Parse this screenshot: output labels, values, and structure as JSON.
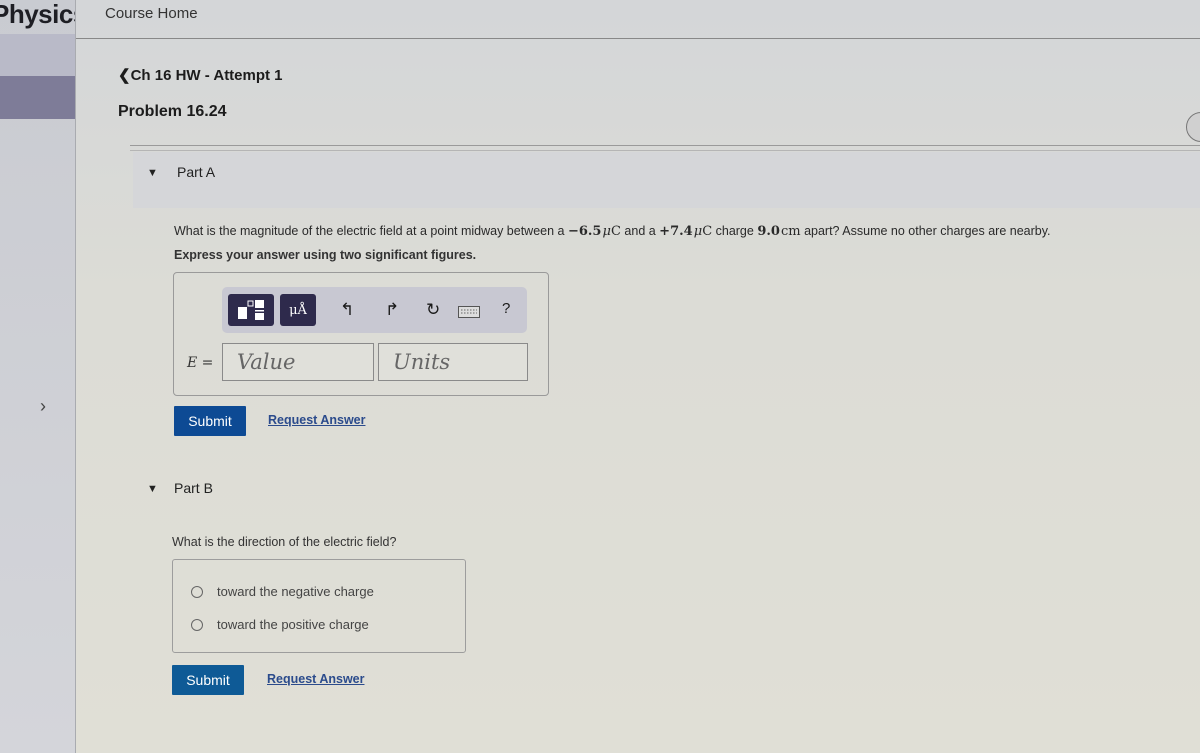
{
  "sidebar": {
    "brand": "Physics",
    "expand_icon": "chevron-right-icon"
  },
  "topbar": {
    "course_home": "Course Home"
  },
  "breadcrumb": {
    "back_label": "Ch 16 HW - Attempt 1"
  },
  "problem": {
    "title": "Problem 16.24"
  },
  "part_a": {
    "label": "Part A",
    "question_pre": "What is the magnitude of the electric field at a point midway between a ",
    "charge1": "−6.5",
    "unit_mu": "μ",
    "unit_c": "C",
    "question_mid1": " and a ",
    "charge2": "+7.4",
    "question_mid2": " charge ",
    "distance": "9.0",
    "distance_unit": "cm",
    "question_post": " apart? Assume no other charges are nearby.",
    "instruction": "Express your answer using two significant figures.",
    "toolbar": {
      "templates_icon": "fraction-template-icon",
      "units_label": "μÅ",
      "undo_icon": "undo-icon",
      "redo_icon": "redo-icon",
      "reset_icon": "reset-icon",
      "keyboard_icon": "keyboard-icon",
      "help_label": "?"
    },
    "variable": "E =",
    "value_placeholder": "Value",
    "units_placeholder": "Units",
    "submit": "Submit",
    "request_answer": "Request Answer"
  },
  "part_b": {
    "label": "Part B",
    "question": "What is the direction of the electric field?",
    "options": [
      "toward the negative charge",
      "toward the positive charge"
    ],
    "submit": "Submit",
    "request_answer": "Request Answer"
  }
}
